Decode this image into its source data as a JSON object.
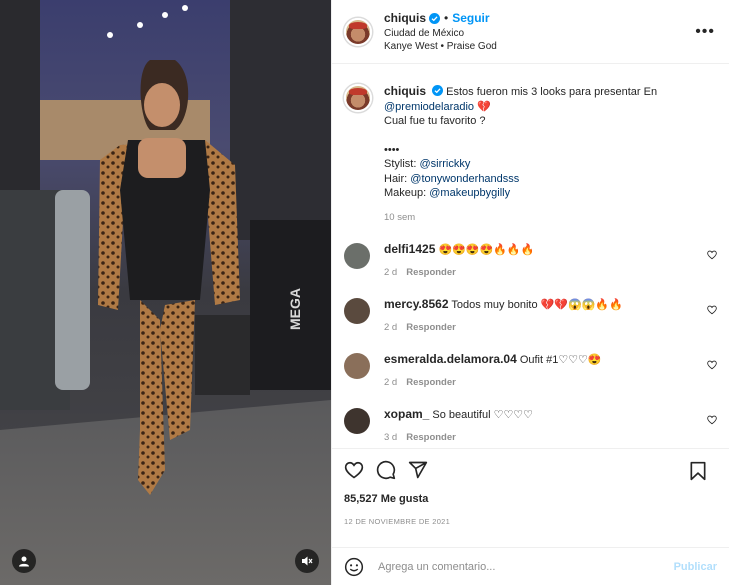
{
  "post": {
    "author": {
      "username": "chiquis",
      "verified": true,
      "follow_label": "Seguir",
      "location": "Ciudad de México",
      "music": "Kanye West • Praise God"
    },
    "more_icon": "more-horizontal-icon",
    "caption": {
      "username": "chiquis",
      "line1": "Estos fueron mis 3 looks para presentar En",
      "mention1": "@premiodelaradio",
      "mention1_emoji": "💔",
      "line2": "Cual fue tu favorito ?",
      "dots": "••••",
      "stylist_label": "Stylist: ",
      "stylist": "@sirrickky",
      "hair_label": "Hair: ",
      "hair": "@tonywonderhandsss",
      "makeup_label": "Makeup: ",
      "makeup": "@makeupbygilly",
      "time": "10 sem"
    },
    "comments": [
      {
        "username": "delfi1425",
        "text": "😍😍😍😍🔥🔥🔥",
        "time": "2 d",
        "reply": "Responder",
        "avatar_color": "#6b6f6a"
      },
      {
        "username": "mercy.8562",
        "text": "Todos muy bonito 💔💔😱😱🔥🔥",
        "time": "2 d",
        "reply": "Responder",
        "avatar_color": "#5a4a3e"
      },
      {
        "username": "esmeralda.delamora.04",
        "text": "Oufit #1♡♡♡😍",
        "time": "2 d",
        "reply": "Responder",
        "avatar_color": "#8a6f5a"
      },
      {
        "username": "xopam_",
        "text": "So beautiful ♡♡♡♡",
        "time": "3 d",
        "reply": "Responder",
        "avatar_color": "#3e342e"
      }
    ],
    "likes": "85,527 Me gusta",
    "date": "12 DE NOVIEMBRE DE 2021",
    "composer": {
      "placeholder": "Agrega un comentario...",
      "publish": "Publicar"
    },
    "colors": {
      "link": "#0095f6",
      "mention": "#00376b",
      "muted": "#8e8e8e",
      "publish_disabled": "#b2dffc"
    }
  }
}
